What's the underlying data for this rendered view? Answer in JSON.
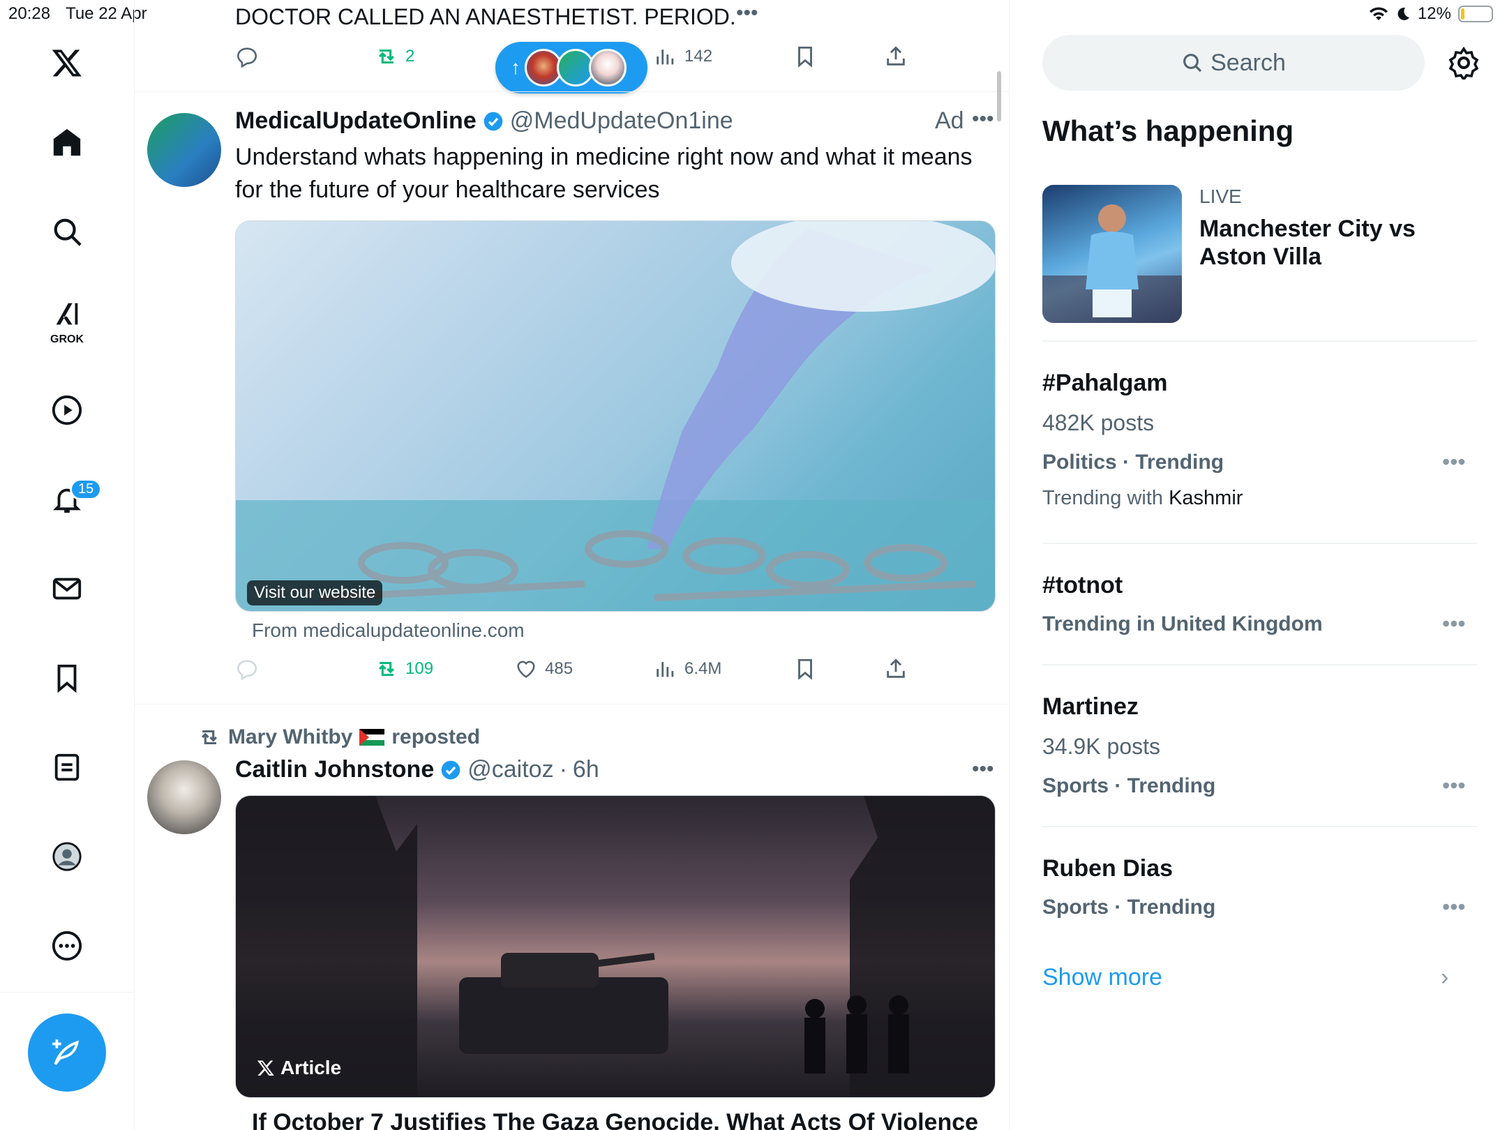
{
  "status_bar": {
    "time": "20:28",
    "date": "Tue 22 Apr",
    "battery": "12%",
    "battery_level": 0.12
  },
  "nav": {
    "grok_label": "GROK",
    "notifications_count": "15"
  },
  "feed": {
    "prev_post": {
      "text": "DOCTOR CALLED AN ANAESTHETIST. PERIOD.",
      "reposts": "2",
      "views": "142"
    },
    "new_posts_pill": {
      "arrow": "↑"
    },
    "ad_post": {
      "name": "MedicalUpdateOnline",
      "handle": "@MedUpdateOn1ine",
      "ad_label": "Ad",
      "text": "Understand whats happening in medicine right now and what it means for the future of your healthcare services",
      "media_label": "Visit our website",
      "from": "From medicalupdateonline.com",
      "reposts": "109",
      "likes": "485",
      "views": "6.4M"
    },
    "second_post": {
      "repost_by": "Mary Whitby",
      "repost_suffix": "reposted",
      "name": "Caitlin Johnstone",
      "handle": "@caitoz",
      "time": "6h",
      "article_label": "Article",
      "article_title": "If October 7 Justifies The Gaza Genocide, What Acts Of Violence"
    }
  },
  "sidebar": {
    "search_placeholder": "Search",
    "section_title": "What’s happening",
    "live": {
      "label": "LIVE",
      "title": "Manchester City vs Aston Villa"
    },
    "trends": [
      {
        "name": "#Pahalgam",
        "count": "482K posts",
        "category": "Politics · Trending",
        "with_prefix": "Trending with",
        "with_value": "Kashmir"
      },
      {
        "name": "#totnot",
        "category": "Trending in United Kingdom"
      },
      {
        "name": "Martinez",
        "count": "34.9K posts",
        "category": "Sports · Trending"
      },
      {
        "name": "Ruben Dias",
        "category": "Sports · Trending"
      }
    ],
    "show_more": "Show more"
  },
  "colors": {
    "accent": "#1d9bf0",
    "repost_green": "#00ba7c",
    "text_secondary": "#536471"
  }
}
